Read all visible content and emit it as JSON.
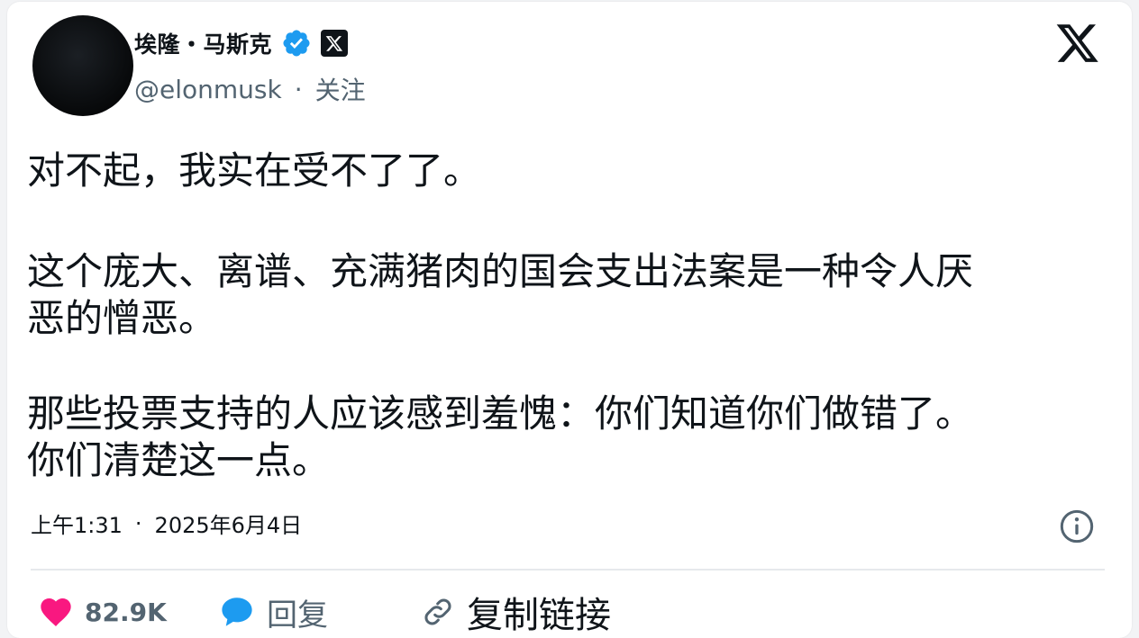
{
  "author": {
    "display_name": "埃隆・马斯克",
    "handle": "@elonmusk",
    "separator": "·",
    "follow_label": "关注"
  },
  "tweet": {
    "paragraphs": [
      "对不起，我实在受不了了。",
      "这个庞大、离谱、充满猪肉的国会支出法案是一种令人厌恶的憎恶。",
      "那些投票支持的人应该感到羞愧：你们知道你们做错了。你们清楚这一点。"
    ],
    "time": "上午1:31",
    "separator": "·",
    "date": "2025年6月4日"
  },
  "actions": {
    "like_count": "82.9K",
    "reply_label": "回复",
    "copy_link_label": "复制链接"
  },
  "icons": {
    "verified": "verified-badge-icon",
    "x_badge": "x-badge-icon",
    "x_logo": "x-logo-icon",
    "info": "info-icon",
    "heart": "heart-icon",
    "reply": "reply-bubble-icon",
    "link": "link-icon"
  },
  "colors": {
    "verified_blue": "#1d9bf0",
    "like_pink": "#f91880",
    "reply_blue": "#1d9bf0",
    "text_primary": "#0f1419",
    "text_secondary": "#536471"
  }
}
